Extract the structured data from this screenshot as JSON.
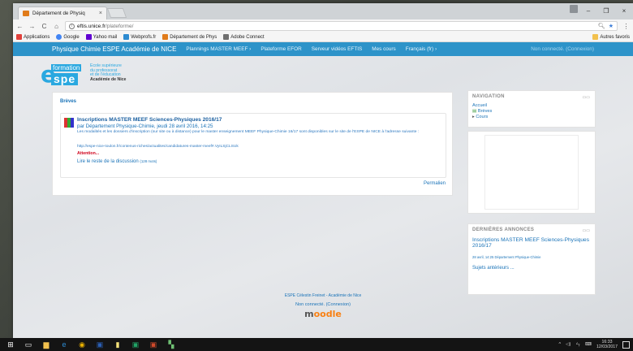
{
  "browser": {
    "tab_title": "Département de Physiq",
    "tab_close": "×",
    "window_controls": [
      "–",
      "❐",
      "×"
    ],
    "url_host": "eftis.unice.fr",
    "url_path": "/plateforme/",
    "bookmarks": [
      {
        "label": "Applications",
        "color": "#e1403b"
      },
      {
        "label": "Google",
        "color": "#4285f4"
      },
      {
        "label": "Yahoo mail",
        "color": "#6001d2"
      },
      {
        "label": "Webprofs.fr",
        "color": "#2d8bd1"
      },
      {
        "label": "Département de Phys",
        "color": "#e07b1a"
      },
      {
        "label": "Adobe Connect",
        "color": "#6f6f6f"
      }
    ],
    "other_bookmarks": "Autres favoris"
  },
  "navbar": {
    "brand": "Physique Chimie ESPE Académie de NICE",
    "items": [
      "Plannings MASTER MEEF ›",
      "Plateforme EFOR",
      "Serveur vidéos EFTIS",
      "Mes cours",
      "Français (fr) ›"
    ],
    "login": "Non connecté. (Connexion)"
  },
  "logo": {
    "formation": "formation",
    "spe": "spe",
    "lines": [
      "Ecole supérieure",
      "du professorat",
      "et de l'éducation",
      "Académie de Nice"
    ]
  },
  "main": {
    "section_title": "Brèves",
    "post": {
      "title": "Inscriptions MASTER MEEF Sciences-Physiques 2016/17",
      "meta": "par Département Physique-Chimie, jeudi 28 avril 2016, 14:25",
      "body": "Les modalités et les dossiers d'inscription (sur site ou à distance) pour le master enseignement MEEF Physique-Chimie 16/17 sont disponibles sur le site de l'ESPE de NICE à l'adresse suivante :",
      "link": "http://espe-nice-toulon.fr/contenus-riches/actualites/candidatures-master-meef#.VyILSjCLSUk",
      "attention": "Attention...",
      "read_more": "Lire le reste de la discussion",
      "word_count": "(128 mots)"
    },
    "permalink": "Permalien"
  },
  "navigation_block": {
    "title": "NAVIGATION",
    "home": "Accueil",
    "items": [
      "Brèves",
      "Cours"
    ]
  },
  "announcements_block": {
    "title": "DERNIÈRES ANNONCES",
    "item_title": "Inscriptions MASTER MEEF Sciences-Physiques 2016/17",
    "item_meta": "28 avril, 14:25 Département Physique-Chimie",
    "older": "Sujets antérieurs ..."
  },
  "footer": {
    "line1": "ESPE Célestin Freinet - Académie de Nice",
    "login": "Non connecté. (Connexion)",
    "moodle": "oodle",
    "moodle_m": "m"
  },
  "taskbar": {
    "time": "16:33",
    "date": "12/03/2017"
  }
}
